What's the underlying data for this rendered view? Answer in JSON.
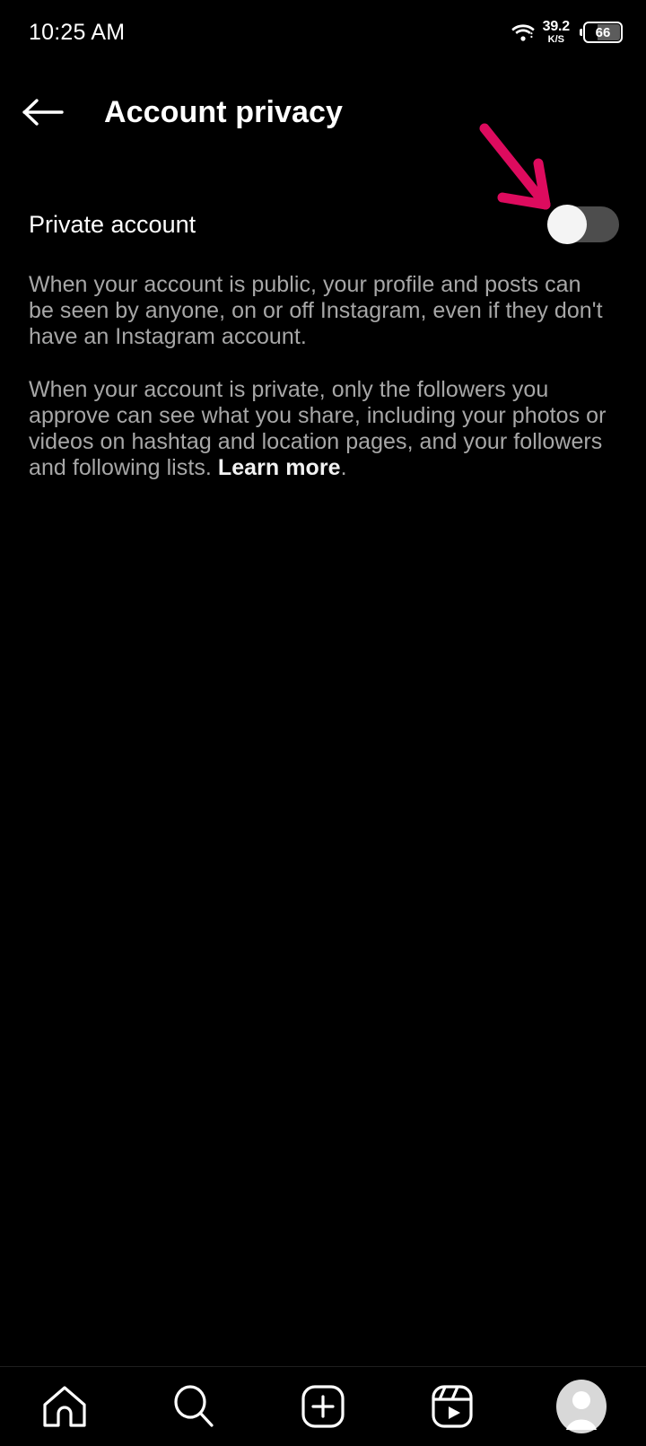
{
  "status_bar": {
    "clock": "10:25 AM",
    "wifi_icon": "wifi-icon",
    "network_speed_value": "39.2",
    "network_speed_unit": "K/S",
    "battery_level": "66"
  },
  "header": {
    "back_icon": "back-arrow-icon",
    "title": "Account privacy"
  },
  "setting": {
    "label": "Private account",
    "toggle_state": "off"
  },
  "annotation": {
    "type": "arrow",
    "color": "#DD0B5E",
    "points_to": "private-account-toggle"
  },
  "description": {
    "paragraph_1": "When your account is public, your profile and posts can be seen by anyone, on or off Instagram, even if they don't have an Instagram account.",
    "paragraph_2_before_link": "When your account is private, only the followers you approve can see what you share, including your photos or videos on hashtag and location pages, and your followers and following lists. ",
    "learn_more_label": "Learn more",
    "paragraph_2_after_link": "."
  },
  "bottom_nav": {
    "items": [
      {
        "name": "home",
        "icon": "home-icon"
      },
      {
        "name": "search",
        "icon": "search-icon"
      },
      {
        "name": "create",
        "icon": "plus-square-icon"
      },
      {
        "name": "reels",
        "icon": "reels-icon"
      },
      {
        "name": "profile",
        "icon": "avatar-icon"
      }
    ]
  },
  "colors": {
    "background": "#000000",
    "primary_text": "#FFFFFF",
    "secondary_text": "#A7A7A7",
    "toggle_track_off": "#4D4D4D",
    "toggle_knob": "#F4F4F4",
    "annotation": "#DD0B5E",
    "divider": "#1E1E1E"
  }
}
